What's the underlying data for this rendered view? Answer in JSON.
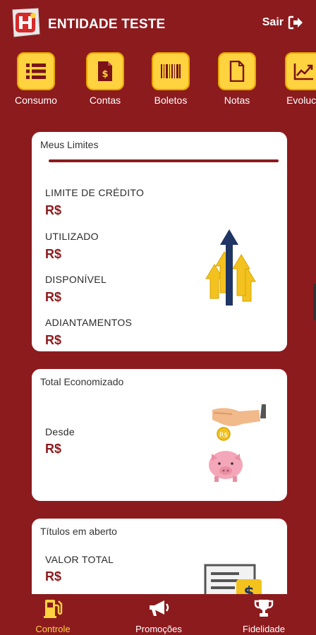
{
  "header": {
    "title": "ENTIDADE TESTE",
    "exit_label": "Sair"
  },
  "quick_actions": [
    {
      "label": "Consumo",
      "icon": "list-icon"
    },
    {
      "label": "Contas",
      "icon": "invoice-dollar-icon"
    },
    {
      "label": "Boletos",
      "icon": "barcode-icon"
    },
    {
      "label": "Notas",
      "icon": "document-icon"
    },
    {
      "label": "Evoluca",
      "icon": "chart-line-icon"
    }
  ],
  "limits_card": {
    "title": "Meus Limites",
    "rows": [
      {
        "label": "LIMITE DE CRÉDITO",
        "value": "R$"
      },
      {
        "label": "UTILIZADO",
        "value": "R$"
      },
      {
        "label": "DISPONÍVEL",
        "value": "R$"
      },
      {
        "label": "ADIANTAMENTOS",
        "value": "R$"
      }
    ]
  },
  "savings_card": {
    "title": "Total Economizado",
    "since_label": "Desde",
    "value": "R$"
  },
  "open_titles_card": {
    "title": "Títulos em aberto",
    "total_label": "VALOR TOTAL",
    "value": "R$"
  },
  "bottom_nav": [
    {
      "label": "Controle",
      "icon": "fuel-pump-icon",
      "active": true
    },
    {
      "label": "Promoções",
      "icon": "megaphone-icon",
      "active": false
    },
    {
      "label": "Fidelidade",
      "icon": "trophy-icon",
      "active": false
    }
  ],
  "colors": {
    "primary": "#8c1b1e",
    "accent": "#ffd23f",
    "card": "#ffffff"
  }
}
